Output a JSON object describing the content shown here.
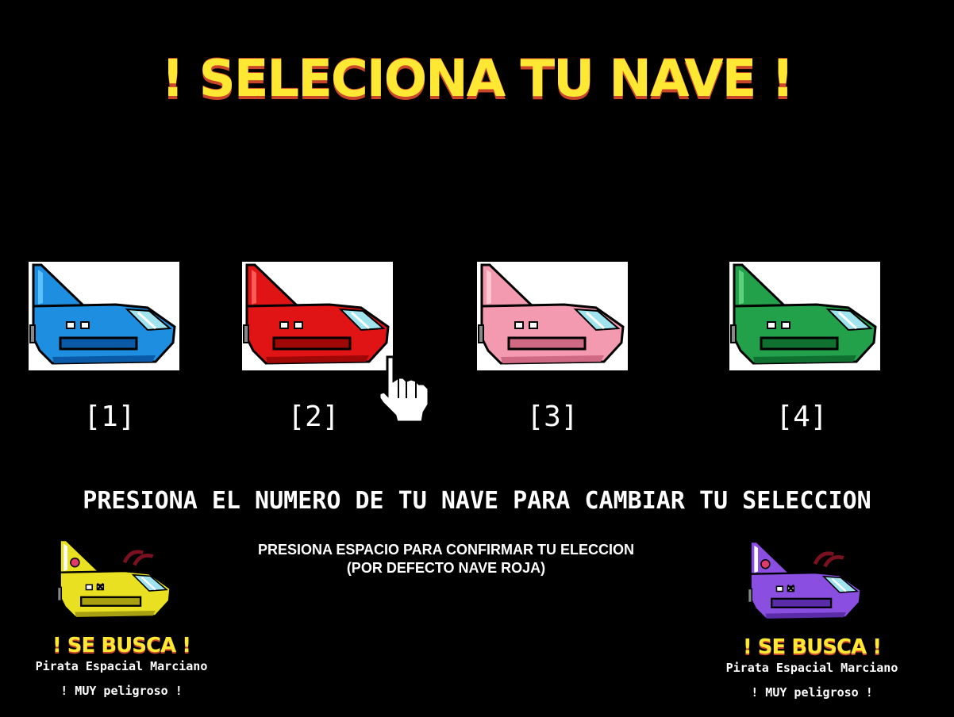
{
  "screen": {
    "title": "! SELECIONA TU NAVE !",
    "background": "#000000",
    "title_color": "#ffe833",
    "title_shadow_color": "#c9462a"
  },
  "ships": [
    {
      "key_label": "[1]",
      "color": "#1e8fe0",
      "dark": "#0a5aa8",
      "light": "#5cc0ff"
    },
    {
      "key_label": "[2]",
      "color": "#e01414",
      "dark": "#a00808",
      "light": "#ff5a5a"
    },
    {
      "key_label": "[3]",
      "color": "#f49ab0",
      "dark": "#d06a84",
      "light": "#ffc6d4"
    },
    {
      "key_label": "[4]",
      "color": "#22a04a",
      "dark": "#0f7030",
      "light": "#5cd07a"
    }
  ],
  "instructions": {
    "change_selection": "PRESIONA EL NUMERO DE TU NAVE PARA CAMBIAR TU SELECCION",
    "confirm_line1": "PRESIONA ESPACIO PARA CONFIRMAR TU ELECCION",
    "confirm_line2": "(POR DEFECTO NAVE ROJA)"
  },
  "wanted_posters": [
    {
      "title": "! SE BUSCA !",
      "subtitle": "Pirata Espacial Marciano",
      "warning": "! MUY peligroso !",
      "ship_color": "#e8e020",
      "ship_dark": "#a8a010",
      "icon": "skull-icon"
    },
    {
      "title": "! SE BUSCA !",
      "subtitle": "Pirata Espacial Marciano",
      "warning": "! MUY peligroso !",
      "ship_color": "#8a4ee0",
      "ship_dark": "#5a2ca8",
      "icon": "skull-icon"
    }
  ],
  "pointer": {
    "icon": "hand-pointer-icon"
  }
}
